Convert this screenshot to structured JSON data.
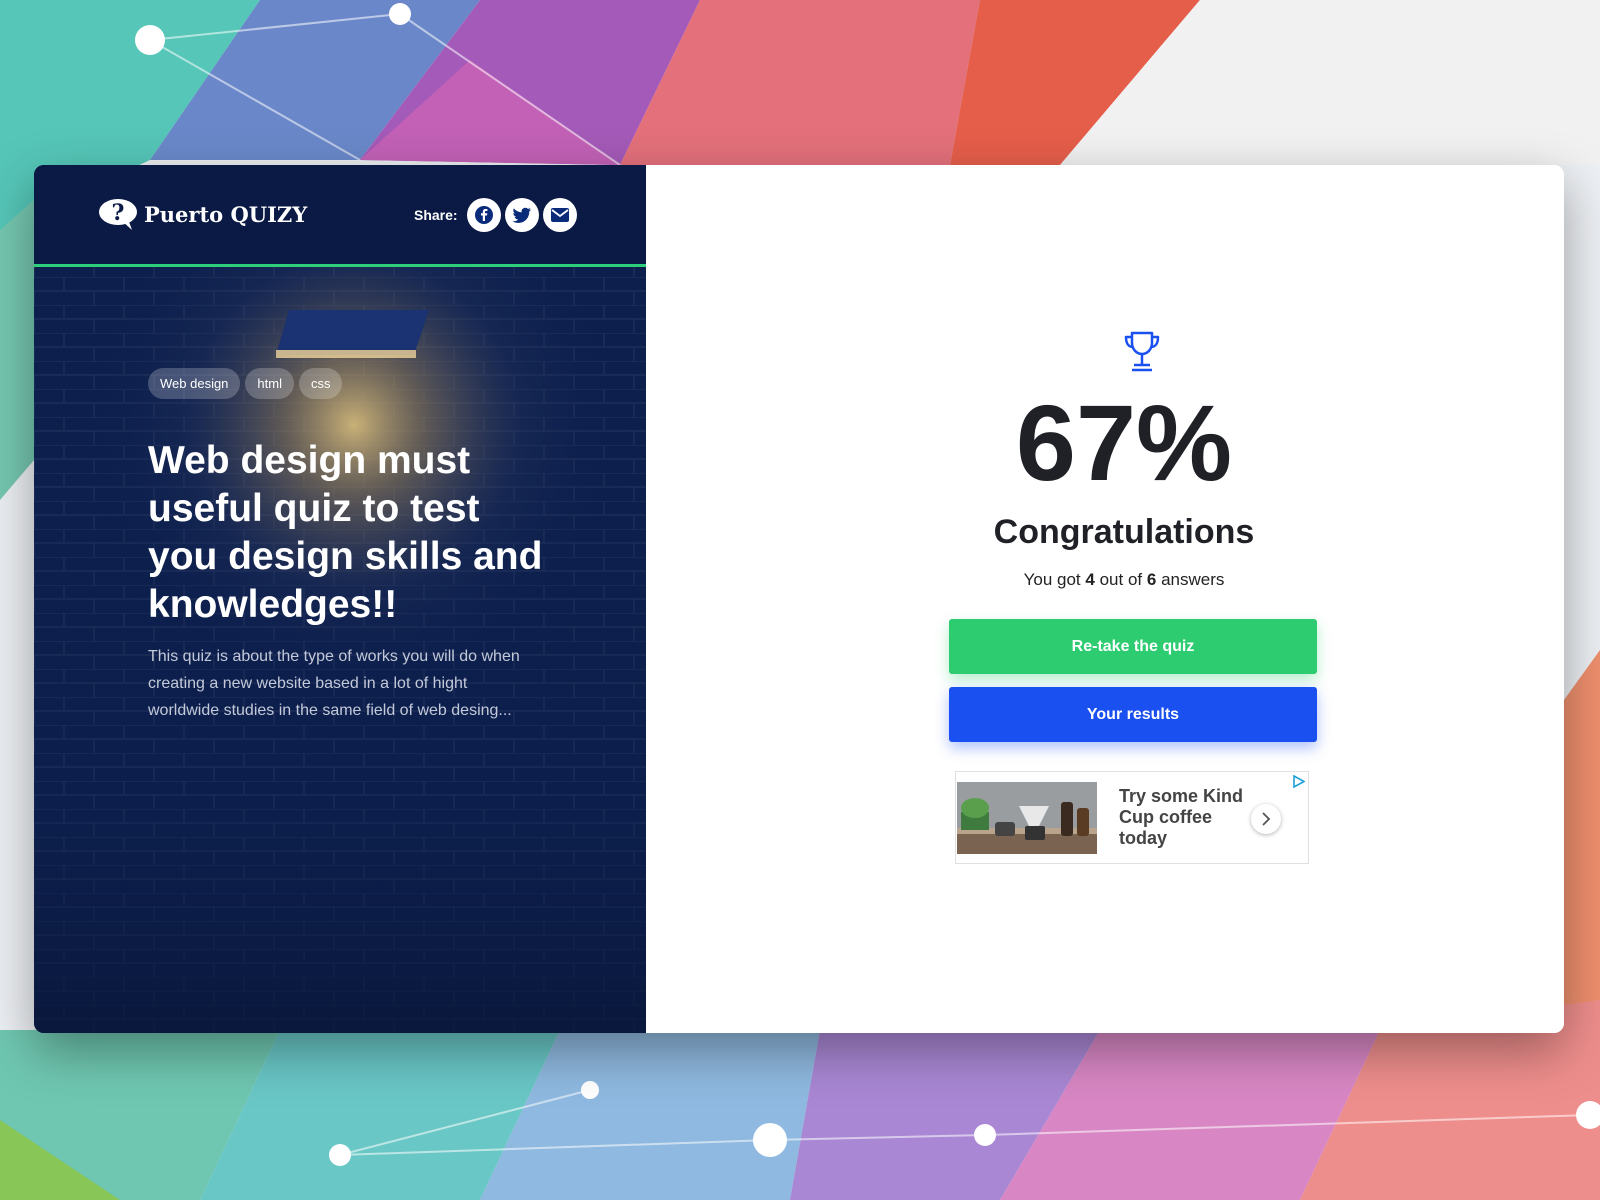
{
  "app": {
    "logo_text": "Puerto QUIZY",
    "share_label": "Share:",
    "share_buttons": [
      {
        "icon": "facebook-icon"
      },
      {
        "icon": "twitter-icon"
      },
      {
        "icon": "envelope-icon"
      }
    ]
  },
  "quiz": {
    "tags": [
      "Web design",
      "html",
      "css"
    ],
    "title": "Web design must useful quiz to test you design skills and knowledges!!",
    "description": "This quiz is about the type of works you will do when creating a new website based in a lot of hight worldwide studies in the same field of web desing..."
  },
  "result": {
    "icon": "trophy-icon",
    "score": "67%",
    "heading": "Congratulations",
    "summary_prefix": "You got",
    "correct": "4",
    "summary_middle": "out of",
    "total": "6",
    "summary_suffix": "answers",
    "retake_label": "Re-take the quiz",
    "results_label": "Your results"
  },
  "ad": {
    "text": "Try some Kind Cup coffee today"
  },
  "colors": {
    "panel_dark": "#0b1d4a",
    "accent_green": "#2ecc71",
    "accent_blue": "#1b50f0",
    "divider_green": "#2ecf7a"
  }
}
